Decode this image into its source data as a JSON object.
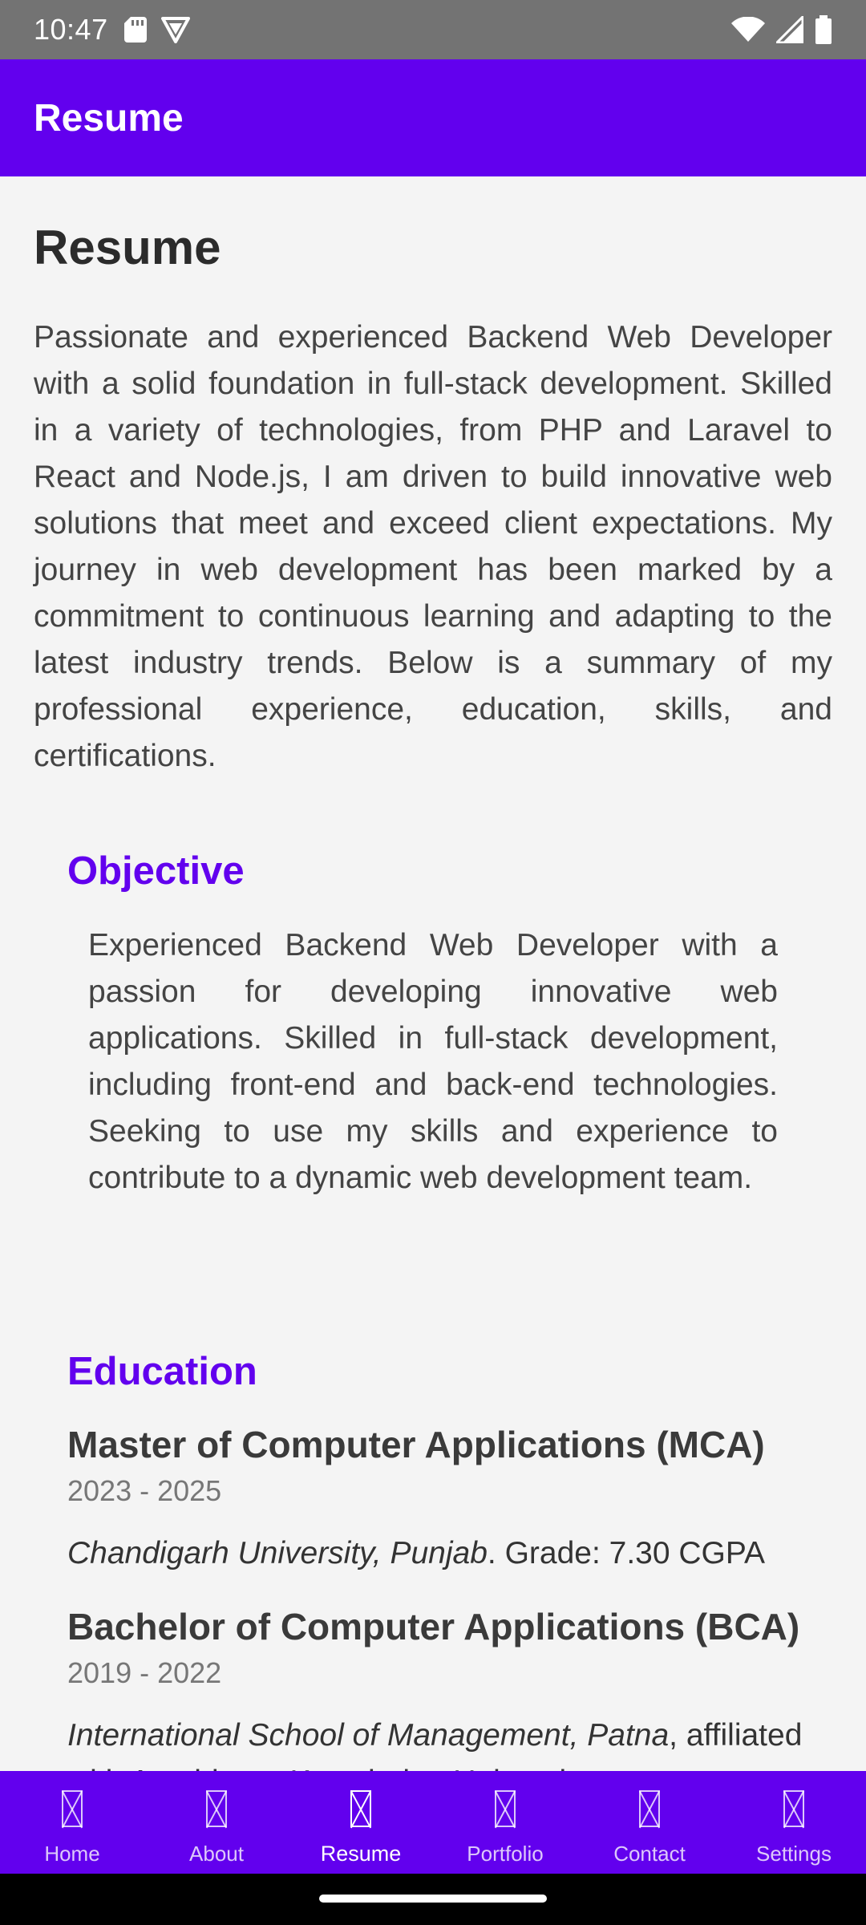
{
  "status_bar": {
    "time": "10:47",
    "icons": [
      "sd-card-icon",
      "shield-icon",
      "wifi-icon",
      "signal-icon",
      "battery-icon"
    ]
  },
  "app_bar": {
    "title": "Resume"
  },
  "page": {
    "heading": "Resume",
    "intro": "Passionate and experienced Backend Web Developer with a solid foundation in full-stack development. Skilled in a variety of technologies, from PHP and Laravel to React and Node.js, I am driven to build innovative web solutions that meet and exceed client expectations. My journey in web development has been marked by a commitment to continuous learning and adapting to the latest industry trends. Below is a summary of my professional experience, education, skills, and certifications.",
    "objective": {
      "title": "Objective",
      "text": "Experienced Backend Web Developer with a passion for developing innovative web applications. Skilled in full-stack development, including front-end and back-end technologies. Seeking to use my skills and experience to contribute to a dynamic web development team."
    },
    "education": {
      "title": "Education",
      "items": [
        {
          "degree": "Master of Computer Applications (MCA)",
          "years": "2023 - 2025",
          "school": "Chandigarh University, Punjab",
          "details": ". Grade: 7.30 CGPA"
        },
        {
          "degree": "Bachelor of Computer Applications (BCA)",
          "years": "2019 - 2022",
          "school": "International School of Management, Patna",
          "details": ", affiliated with Aryabhatta Knowledge University"
        }
      ]
    }
  },
  "bottom_nav": {
    "items": [
      {
        "label": "Home",
        "active": false
      },
      {
        "label": "About",
        "active": false
      },
      {
        "label": "Resume",
        "active": true
      },
      {
        "label": "Portfolio",
        "active": false
      },
      {
        "label": "Contact",
        "active": false
      },
      {
        "label": "Settings",
        "active": false
      }
    ]
  },
  "colors": {
    "primary": "#6200ee",
    "status_bar": "#737373",
    "background": "#f4f4f4"
  }
}
